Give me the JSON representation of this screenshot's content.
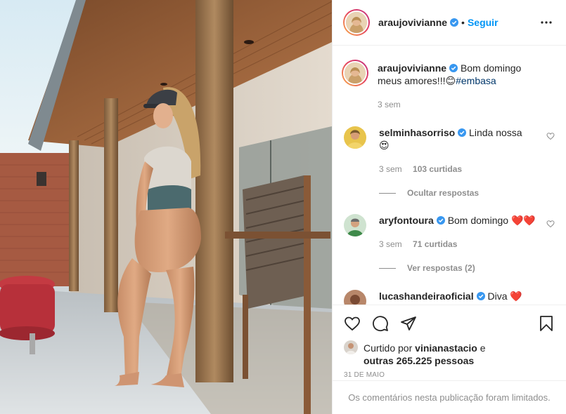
{
  "post": {
    "author": "araujovivianne",
    "follow_label": "Seguir",
    "separator": "•",
    "caption": {
      "author": "araujovivianne",
      "text": "Bom domingo meus amores!!!",
      "emoji": "😊",
      "hashtag": "#embasa",
      "time": "3 sem"
    },
    "comments": [
      {
        "user": "selminhasorriso",
        "text": "Linda nossa",
        "emoji": "😍",
        "time": "3 sem",
        "likes": "103 curtidas",
        "replies_label": "Ocultar respostas"
      },
      {
        "user": "aryfontoura",
        "text": "Bom domingo",
        "emoji": "❤️❤️",
        "time": "3 sem",
        "likes": "71 curtidas",
        "replies_label": "Ver respostas (2)"
      },
      {
        "user": "lucashandeiraoficial",
        "text": "Diva",
        "emoji": "❤️"
      }
    ],
    "liked_by_prefix": "Curtido por",
    "liked_by_user": "vinianastacio",
    "liked_by_and": "e",
    "liked_by_others": "outras 265.225 pessoas",
    "date": "31 de maio",
    "comments_limited": "Os comentários nesta publicação foram limitados."
  },
  "colors": {
    "accent": "#0095f6",
    "text": "#262626",
    "muted": "#8e8e8e",
    "heart": "#ed4956",
    "hashtag": "#00376b"
  },
  "icons": [
    "verified-badge-icon",
    "more-options-icon",
    "heart-outline-icon",
    "comment-icon",
    "share-icon",
    "bookmark-icon"
  ]
}
